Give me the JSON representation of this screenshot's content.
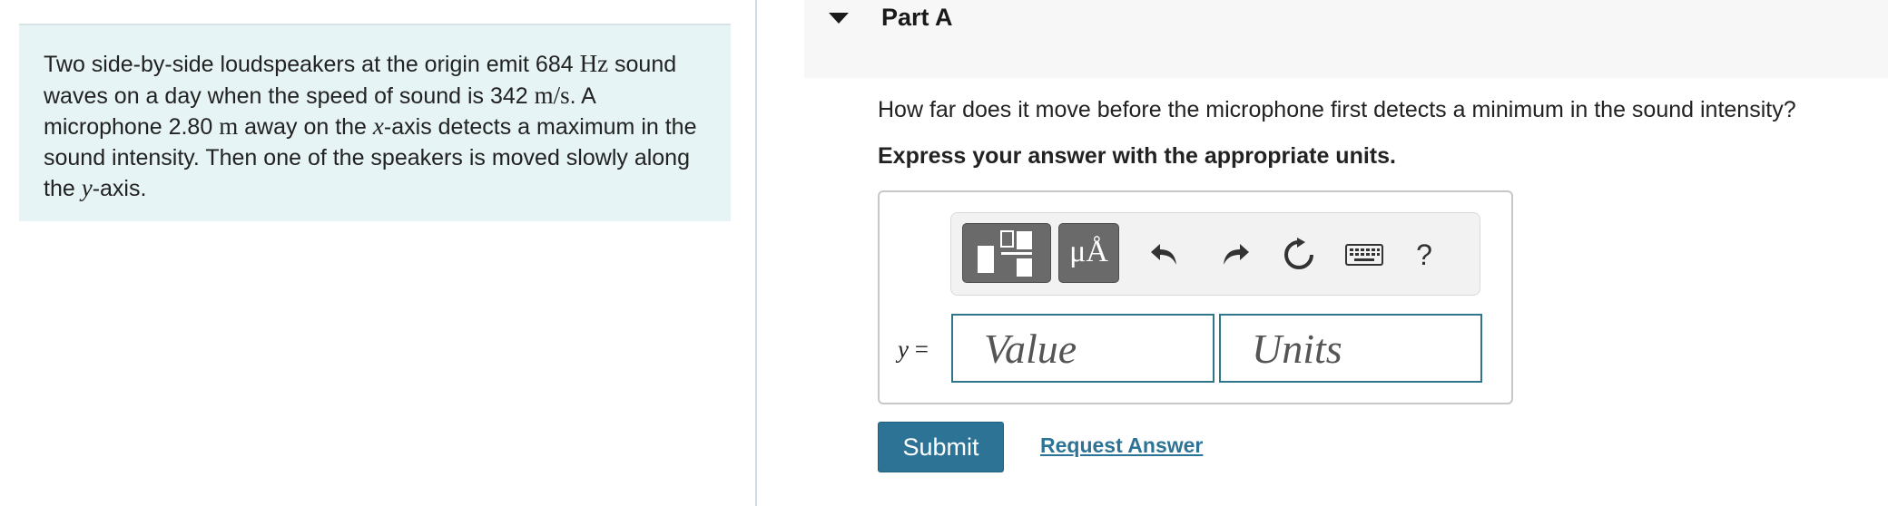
{
  "problem": {
    "text_1": "Two side-by-side loudspeakers at the origin emit 684 ",
    "unit_hz": "Hz",
    "text_2": " sound waves on a day when the speed of sound is 342 ",
    "unit_speed": "m/s",
    "text_3": ". A microphone 2.80 ",
    "unit_m": "m",
    "text_4": " away on the ",
    "var_x": "x",
    "text_5": "-axis detects a maximum in the sound intensity. Then one of the speakers is moved slowly along the ",
    "var_y": "y",
    "text_6": "-axis."
  },
  "part": {
    "title": "Part A",
    "question": "How far does it move before the microphone first detects a minimum in the sound intensity?",
    "instruction": "Express your answer with the appropriate units."
  },
  "toolbar": {
    "units_label": "μÅ",
    "help_label": "?",
    "icons": [
      "templates-icon",
      "units-icon",
      "undo-icon",
      "redo-icon",
      "reset-icon",
      "keyboard-icon",
      "help-icon"
    ]
  },
  "answer": {
    "variable": "y",
    "equals": "=",
    "value_placeholder": "Value",
    "units_placeholder": "Units"
  },
  "actions": {
    "submit_label": "Submit",
    "request_label": "Request Answer"
  },
  "colors": {
    "problem_bg": "#e7f4f5",
    "accent": "#2d7396",
    "field_border": "#30768b",
    "toolbar_button": "#6a6a6a"
  }
}
